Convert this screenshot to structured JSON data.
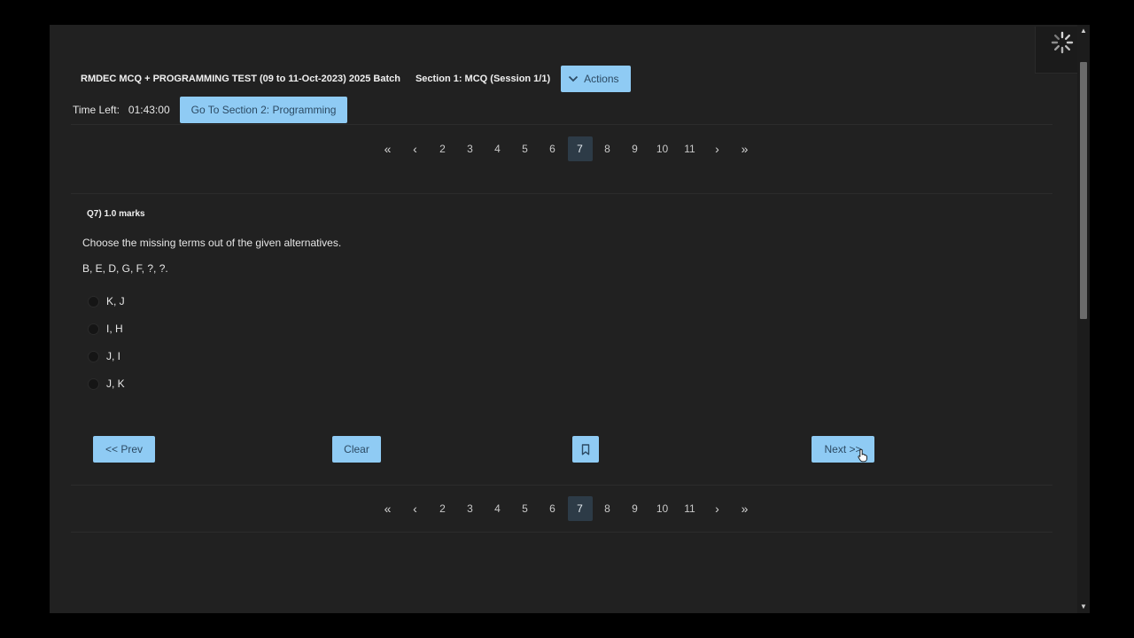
{
  "header": {
    "test_title": "RMDEC MCQ + PROGRAMMING TEST (09 to 11-Oct-2023) 2025 Batch",
    "section_label": "Section 1: MCQ (Session 1/1)",
    "actions_label": "Actions"
  },
  "timer": {
    "label": "Time Left:",
    "value": "01:43:00",
    "section_button": "Go To Section 2: Programming"
  },
  "pagination": {
    "first": "«",
    "prev": "‹",
    "pages": [
      "2",
      "3",
      "4",
      "5",
      "6",
      "7",
      "8",
      "9",
      "10",
      "11"
    ],
    "current": "7",
    "next": "›",
    "last": "»"
  },
  "question": {
    "header": "Q7) 1.0 marks",
    "text": "Choose the missing terms out of the given alternatives.",
    "sequence": "B, E, D, G, F, ?, ?.",
    "options": [
      "K, J",
      "I, H",
      "J, I",
      "J, K"
    ]
  },
  "buttons": {
    "prev": "<< Prev",
    "clear": "Clear",
    "next": "Next >>"
  },
  "icons": {
    "loader": "spinner-icon",
    "bookmark": "bookmark-icon",
    "actions": "chevron-down-icon",
    "cursor": "hand-pointer-icon"
  },
  "colors": {
    "button_bg": "#8fcbf4",
    "button_text": "#2c4a63",
    "active_page": "#2d3b47",
    "background": "#212121"
  }
}
